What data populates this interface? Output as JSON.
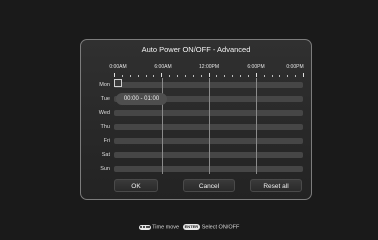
{
  "dialog": {
    "title": "Auto Power ON/OFF - Advanced",
    "time_labels": [
      "0:00AM",
      "6:00AM",
      "12:00PM",
      "6:00PM",
      "0:00PM"
    ],
    "days": [
      "Mon",
      "Tue",
      "Wed",
      "Thu",
      "Fri",
      "Sat",
      "Sun"
    ],
    "tooltip": "00:00 - 01:00",
    "buttons": {
      "ok": "OK",
      "cancel": "Cancel",
      "reset": "Reset all"
    }
  },
  "footer": {
    "time_move_label": "Time move",
    "enter_key": "ENTER",
    "select_label": "Select ON/OFF"
  }
}
